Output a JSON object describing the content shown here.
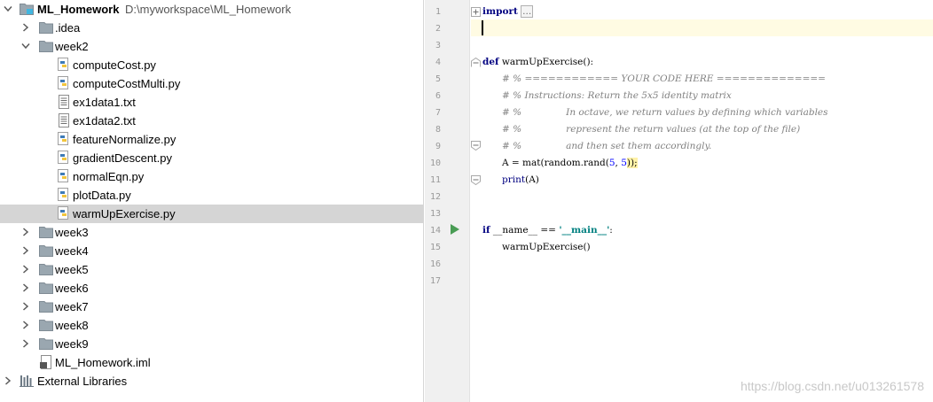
{
  "project": {
    "root_name": "ML_Homework",
    "root_path": "D:\\myworkspace\\ML_Homework",
    "items": [
      {
        "label": "ML_Homework",
        "type": "root",
        "depth": 0,
        "expanded": true
      },
      {
        "label": ".idea",
        "type": "folder",
        "depth": 1,
        "expanded": false
      },
      {
        "label": "week2",
        "type": "folder",
        "depth": 1,
        "expanded": true
      },
      {
        "label": "computeCost.py",
        "type": "python",
        "depth": 2
      },
      {
        "label": "computeCostMulti.py",
        "type": "python",
        "depth": 2
      },
      {
        "label": "ex1data1.txt",
        "type": "text",
        "depth": 2
      },
      {
        "label": "ex1data2.txt",
        "type": "text",
        "depth": 2
      },
      {
        "label": "featureNormalize.py",
        "type": "python",
        "depth": 2
      },
      {
        "label": "gradientDescent.py",
        "type": "python",
        "depth": 2
      },
      {
        "label": "normalEqn.py",
        "type": "python",
        "depth": 2
      },
      {
        "label": "plotData.py",
        "type": "python",
        "depth": 2
      },
      {
        "label": "warmUpExercise.py",
        "type": "python",
        "depth": 2,
        "selected": true
      },
      {
        "label": "week3",
        "type": "folder",
        "depth": 1,
        "expanded": false
      },
      {
        "label": "week4",
        "type": "folder",
        "depth": 1,
        "expanded": false
      },
      {
        "label": "week5",
        "type": "folder",
        "depth": 1,
        "expanded": false
      },
      {
        "label": "week6",
        "type": "folder",
        "depth": 1,
        "expanded": false
      },
      {
        "label": "week7",
        "type": "folder",
        "depth": 1,
        "expanded": false
      },
      {
        "label": "week8",
        "type": "folder",
        "depth": 1,
        "expanded": false
      },
      {
        "label": "week9",
        "type": "folder",
        "depth": 1,
        "expanded": false
      },
      {
        "label": "ML_Homework.iml",
        "type": "iml",
        "depth": 1
      },
      {
        "label": "External Libraries",
        "type": "libraries",
        "depth": 0,
        "expanded": false
      }
    ]
  },
  "editor": {
    "line_numbers": [
      "1",
      "2",
      "3",
      "4",
      "5",
      "6",
      "7",
      "8",
      "9",
      "10",
      "11",
      "12",
      "13",
      "14",
      "15",
      "16",
      "17"
    ],
    "code": {
      "l1_kw": "import",
      "l1_fold": "...",
      "l5_kw": "def",
      "l5_name": "warmUpExercise",
      "l5_rest": "():",
      "l6": "# % ============ YOUR CODE HERE ==============",
      "l7": "# % Instructions: Return the 5x5 identity matrix",
      "l8": "# %               In octave, we return values by defining which variables",
      "l9": "# %               represent the return values (at the top of the file)",
      "l10": "# %               and then set them accordingly.",
      "l11_a": "A = mat(random.rand(",
      "l11_n1": "5",
      "l11_sep": ", ",
      "l11_n2": "5",
      "l11_end": "));",
      "l12_fn": "print",
      "l12_rest": "(A)",
      "l15_kw": "if",
      "l15_name": " __name__ == ",
      "l15_str": "'__main__'",
      "l15_end": ":",
      "l16": "warmUpExercise()"
    }
  },
  "watermark": "https://blog.csdn.net/u013261578",
  "colors": {
    "keyword": "#000080",
    "comment": "#808080",
    "number": "#0000ff",
    "string": "#008080",
    "selection": "#d5d5d5",
    "current_line": "#fffbe3",
    "run_icon": "#499c54"
  }
}
